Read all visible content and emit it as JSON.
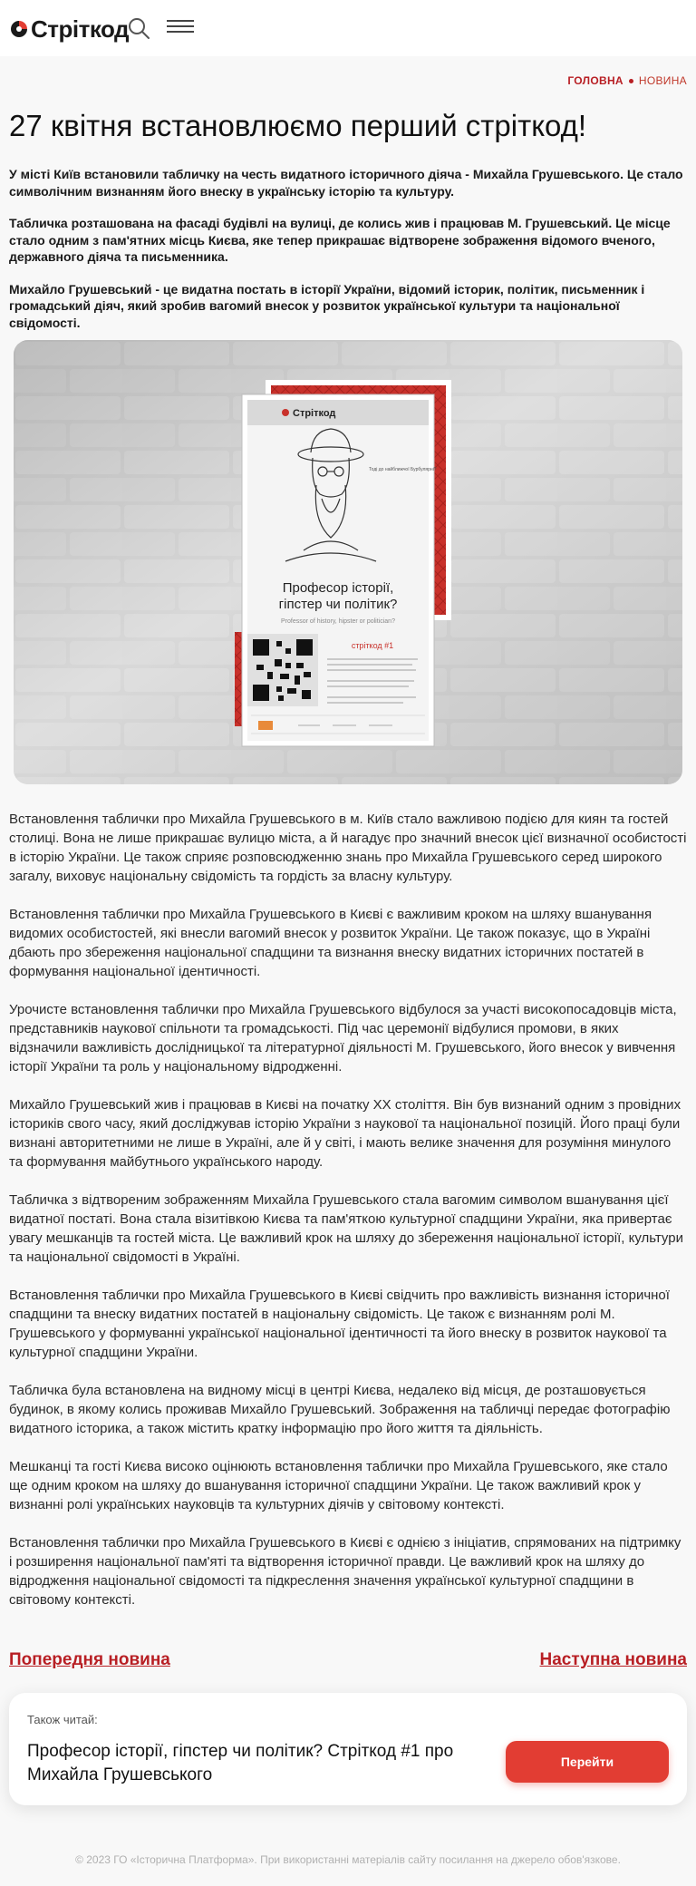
{
  "header": {
    "logo_text": "Стріткод",
    "search_icon": "search-icon",
    "menu_icon": "hamburger-menu-icon"
  },
  "breadcrumb": {
    "home": "ГОЛОВНА",
    "current": "НОВИНА"
  },
  "article": {
    "title": "27 квітня встановлюємо перший стріткод!",
    "intro": [
      "У місті Київ встановили табличку на честь видатного історичного діяча - Михайла Грушевського. Це стало символічним визнанням його внеску в українську історію та культуру.",
      "Табличка розташована на фасаді будівлі на вулиці, де колись жив і працював М. Грушевський. Це місце стало одним з пам'ятних місць Києва, яке тепер прикрашає відтворене зображення відомого вченого, державного діяча та письменника.",
      "Михайло Грушевський - це видатна постать в історії України, відомий історик, політик, письменник і громадський діяч, який зробив вагомий внесок у розвиток української культури та національної свідомості."
    ],
    "hero_image": {
      "plaque_logo": "Стріткод",
      "plaque_heading_line1": "Професор історії,",
      "plaque_heading_line2": "гіпстер чи політик?",
      "plaque_subheading": "Professor of history, hipster or politician?",
      "plaque_code": "стріткод #1",
      "speech_bubble": "Тоді до найближчої Бурбулярні?"
    },
    "body": [
      "Встановлення таблички про Михайла Грушевського в м. Київ стало важливою подією для киян та гостей столиці. Вона не лише прикрашає вулицю міста, а й нагадує про значний внесок цієї визначної особистості в історію України. Це також сприяє розповсюдженню знань про Михайла Грушевського серед широкого загалу, виховує національну свідомість та гордість за власну культуру.",
      "Встановлення таблички про Михайла Грушевського в Києві є важливим кроком на шляху вшанування видомих особистостей, які внесли вагомий внесок у розвиток України. Це також показує, що в Україні дбають про збереження національної спадщини та визнання внеску видатних історичних постатей в формування національної ідентичності.",
      "Урочисте встановлення таблички про Михайла Грушевського відбулося за участі високопосадовців міста, представників наукової спільноти та громадськості. Під час церемонії відбулися промови, в яких відзначили важливість дослідницької та літературної діяльності М. Грушевського, його внесок у вивчення історії України та роль у національному відродженні.",
      "Михайло Грушевський жив і працював в Києві на початку XX століття. Він був визнаний одним з провідних істориків свого часу, який досліджував історію України з наукової та національної позицій. Його праці були визнані авторитетними не лише в Україні, але й у світі, і мають велике значення для розуміння минулого та формування майбутнього українського народу.",
      "Табличка з відтвореним зображенням Михайла Грушевського стала вагомим символом вшанування цієї видатної постаті. Вона стала візитівкою Києва та пам'яткою культурної спадщини України, яка привертає увагу мешканців та гостей міста. Це важливий крок на шляху до збереження національної історії, культури та національної свідомості в Україні.",
      "Встановлення таблички про Михайла Грушевського в Києві свідчить про важливість визнання історичної спадщини та внеску видатних постатей в національну свідомість. Це також є визнанням ролі М. Грушевського у формуванні української національної ідентичності та його внеску в розвиток наукової та культурної спадщини України.",
      "Табличка була встановлена на видному місці в центрі Києва, недалеко від місця, де розташовується будинок, в якому колись проживав Михайло Грушевський. Зображення на табличці передає фотографію видатного історика, а також містить кратку інформацію про його життя та діяльність.",
      "Мешканці та гості Києва високо оцінюють встановлення таблички про Михайла Грушевського, яке стало ще одним кроком на шляху до вшанування історичної спадщини України. Це також важливий крок у визнанні ролі українських науковців та культурних діячів у світовому контексті.",
      "Встановлення таблички про Михайла Грушевського в Києві є однією з ініціатив, спрямованих на підтримку і розширення національної пам'яті та відтворення історичної правди. Це важливий крок на шляху до відродження національної свідомості та підкреслення значення української культурної спадщини в світовому контексті."
    ]
  },
  "navigation": {
    "prev": "Попередня новина",
    "next": "Наступна новина"
  },
  "read_also": {
    "label": "Також читай:",
    "title": "Професор історії, гіпстер чи політик? Стріткод #1 про Михайла Грушевського",
    "button": "Перейти"
  },
  "footer": {
    "text": "© 2023 ГО «Історична Платформа». При використанні матеріалів сайту посилання на джерело обов'язкове."
  },
  "colors": {
    "accent": "#b81f24",
    "button": "#e23d33",
    "background": "#f8f8f8"
  }
}
